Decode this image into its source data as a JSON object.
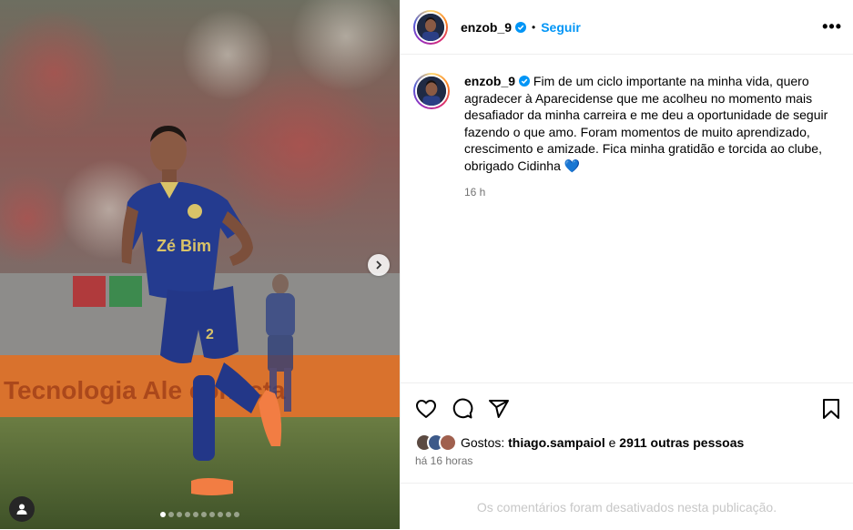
{
  "post": {
    "username": "enzob_9",
    "follow_label": "Seguir",
    "separator": "•",
    "more_label": "•••",
    "caption": "Fim de um ciclo importante na minha vida, quero agradecer à Aparecidense que me acolheu no momento mais desafiador da minha carreira e me deu a oportunidade de seguir fazendo o que amo. Foram momentos de muito aprendizado, crescimento e amizade. Fica minha gratidão e torcida ao clube, obrigado Cidinha 💙",
    "caption_time": "16 h",
    "likes_prefix": "Gostos:",
    "likes_user": "thiago.sampaiol",
    "likes_join": "e",
    "likes_others": "2911 outras pessoas",
    "posted_ago": "há 16 horas",
    "comments_disabled": "Os comentários foram desativados nesta publicação."
  },
  "media": {
    "banner_text": "Tecnologia Ale   conecta",
    "carousel_total": 10,
    "carousel_active": 1
  },
  "colors": {
    "link": "#0095f6",
    "verified": "#0095f6",
    "muted": "#737373",
    "divider": "#efefef"
  },
  "icons": [
    "heart-icon",
    "comment-icon",
    "share-icon",
    "bookmark-icon",
    "verified-icon",
    "chevron-right-icon",
    "user-tag-icon",
    "more-icon"
  ]
}
